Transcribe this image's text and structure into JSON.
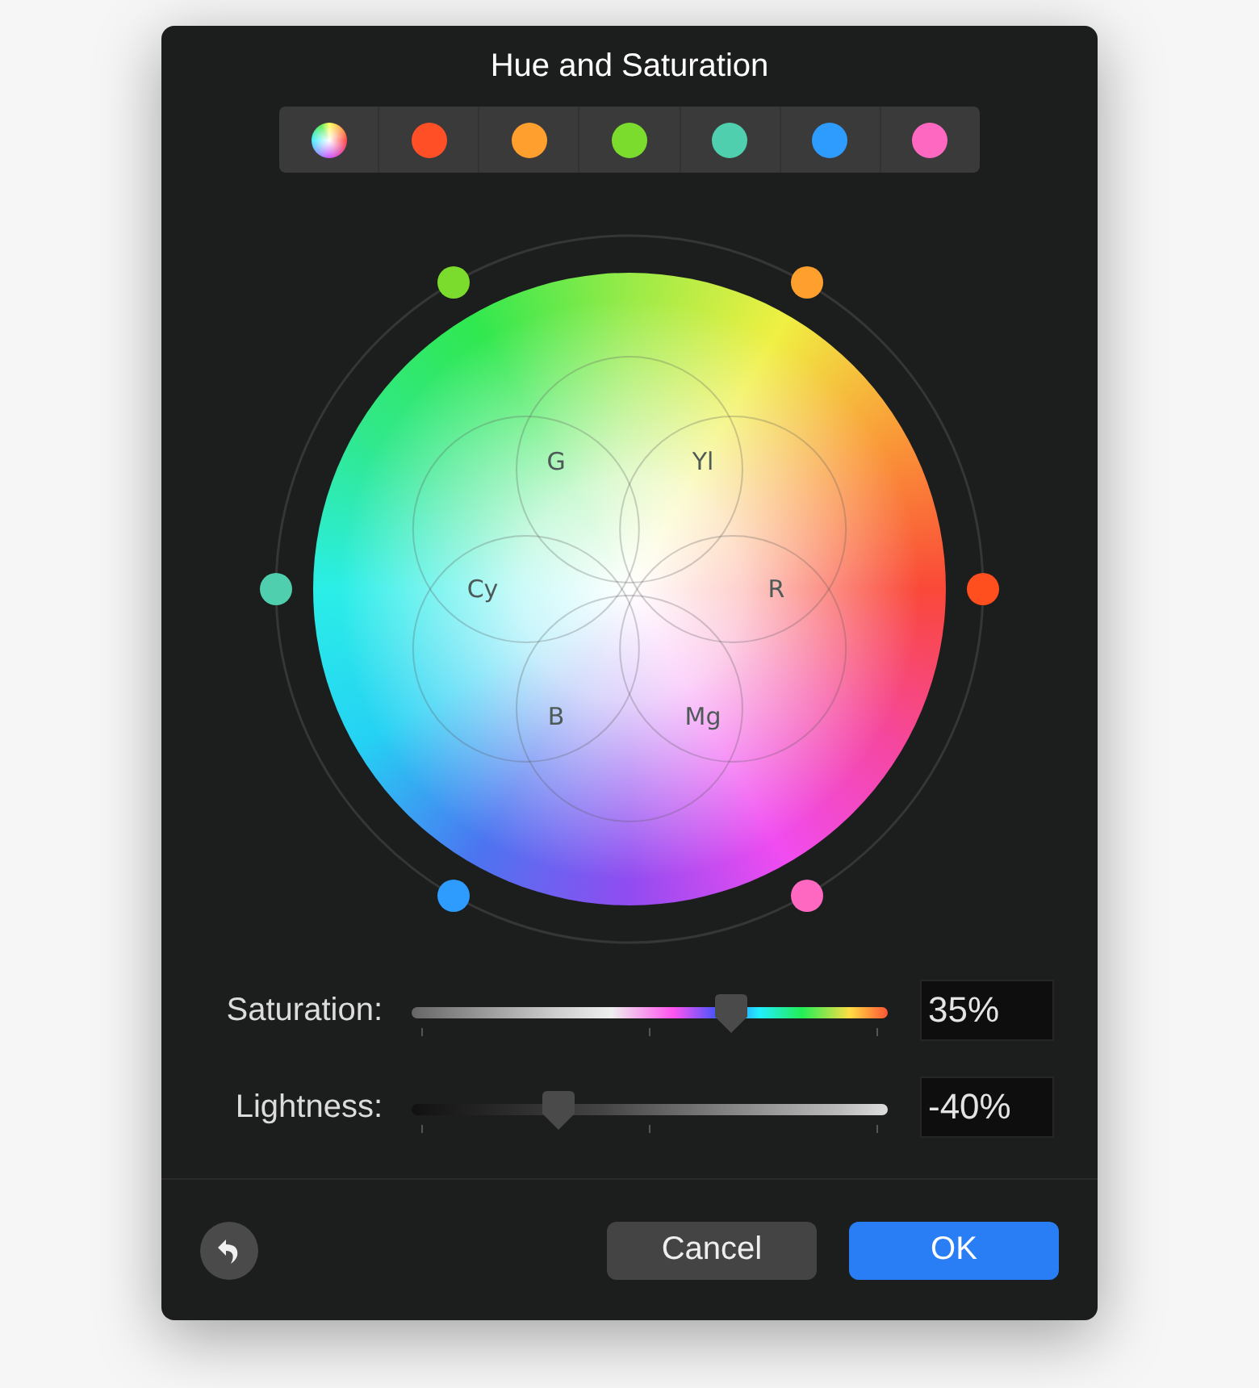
{
  "window": {
    "title": "Hue and Saturation"
  },
  "tabs": [
    {
      "kind": "all"
    },
    {
      "kind": "swatch",
      "color": "#ff4f26"
    },
    {
      "kind": "swatch",
      "color": "#ff9f2e"
    },
    {
      "kind": "swatch",
      "color": "#7cdc2e"
    },
    {
      "kind": "swatch",
      "color": "#4fcfae"
    },
    {
      "kind": "swatch",
      "color": "#2e9cff"
    },
    {
      "kind": "swatch",
      "color": "#ff68c0"
    }
  ],
  "hues": [
    {
      "label": "R",
      "color": "#ff4f1f"
    },
    {
      "label": "Yl",
      "color": "#ff9f2e"
    },
    {
      "label": "G",
      "color": "#7cdc2e"
    },
    {
      "label": "Cy",
      "color": "#4fcfae"
    },
    {
      "label": "B",
      "color": "#2e9cff"
    },
    {
      "label": "Mg",
      "color": "#ff68c0"
    }
  ],
  "sliders": [
    {
      "label": "Saturation:",
      "kind": "spectrum",
      "level": 0.67,
      "value": "35%"
    },
    {
      "label": "Lightness:",
      "kind": "gray",
      "level": 0.31,
      "value": "-40%"
    }
  ],
  "buttons": [
    {
      "label": "Cancel",
      "kind": "secondary"
    },
    {
      "label": "OK",
      "kind": "primary"
    }
  ]
}
